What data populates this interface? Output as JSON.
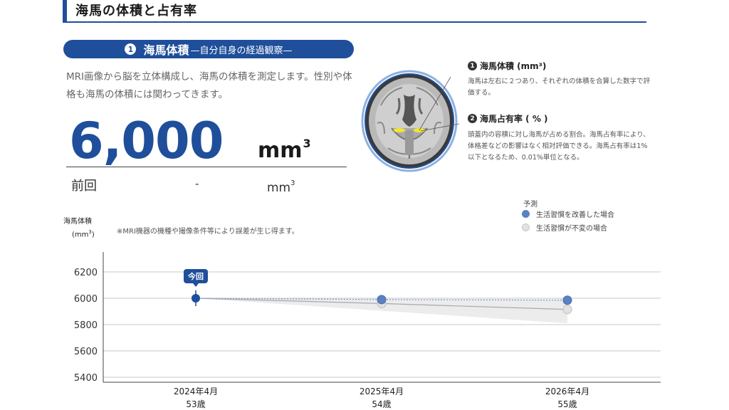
{
  "header": {
    "title": "海馬の体積と占有率"
  },
  "section": {
    "number": "1",
    "title": "海馬体積",
    "subtitle": "—自分自身の経過観察—"
  },
  "description": "MRI画像から脳を立体構成し、海馬の体積を測定します。性別や体格も海馬の体積には関わってきます。",
  "current": {
    "value": "6,000",
    "unit": "mm",
    "unit_exp": "3"
  },
  "previous": {
    "label": "前回",
    "value": "-",
    "unit": "mm",
    "unit_exp": "3"
  },
  "notes": [
    {
      "number": "1",
      "title": "海馬体積 (mm³)",
      "text": "海馬は左右に２つあり、それぞれの体積を合算した数字で評価する。"
    },
    {
      "number": "2",
      "title": "海馬占有率 ( % )",
      "text": "頭蓋内の容積に対し海馬が占める割合。海馬占有率により、体格差などの影響はなく相対評価できる。海馬占有率は1%以下となるため、0.01%単位となる。"
    }
  ],
  "legend": {
    "title": "予測",
    "items": [
      {
        "label": "生活習慣を改善した場合",
        "color": "#5b82c0"
      },
      {
        "label": "生活習慣が不変の場合",
        "color": "#e2e2e2"
      }
    ]
  },
  "chart_note": "※MRI機器の機種や撮像条件等により誤差が生じ得ます。",
  "colors": {
    "accent": "#1f4f9b",
    "improved": "#5b82c0",
    "unchanged": "#e2e2e2"
  },
  "chart_data": {
    "type": "line",
    "ylabel": "海馬体積",
    "ylabel_unit": "(mm",
    "ylabel_unit_exp": "3",
    "ylabel_unit_close": ")",
    "ylim": [
      5400,
      6200
    ],
    "yticks": [
      6200,
      6000,
      5800,
      5600,
      5400
    ],
    "categories": [
      "2024年4月|53歳",
      "2025年4月|54歳",
      "2026年4月|55歳"
    ],
    "current_label": "今回",
    "current_value": 6000,
    "current_error": [
      5940,
      6060
    ],
    "series": [
      {
        "name": "生活習慣を改善した場合",
        "values": [
          6000,
          5990,
          5985
        ]
      },
      {
        "name": "生活習慣が不変の場合",
        "values": [
          6000,
          5960,
          5915
        ]
      }
    ],
    "band": {
      "upper": [
        6000,
        5995,
        5995
      ],
      "lower": [
        6000,
        5905,
        5810
      ]
    },
    "grid": true
  }
}
